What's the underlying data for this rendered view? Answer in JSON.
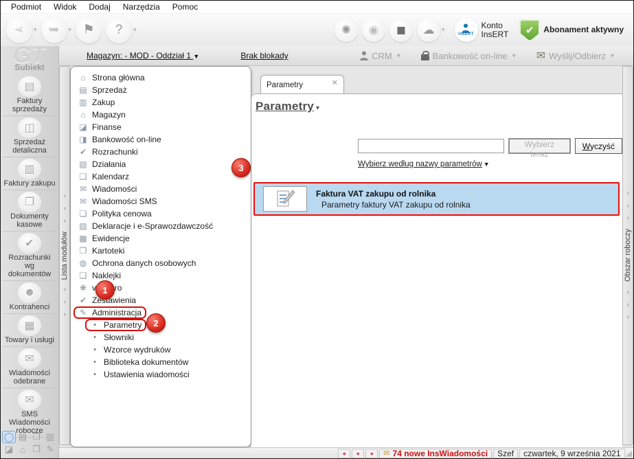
{
  "menu_bar": {
    "items": [
      {
        "label": "Podmiot"
      },
      {
        "label": "Widok"
      },
      {
        "label": "Dodaj"
      },
      {
        "label": "Narzędzia"
      },
      {
        "label": "Pomoc"
      }
    ]
  },
  "toolbar": {
    "left_buttons": [
      {
        "icon_name": "back-arrow-icon",
        "glyph": "➢",
        "dropdown": true,
        "disabled": true,
        "flip": true
      },
      {
        "icon_name": "forward-arrow-icon",
        "glyph": "➥",
        "dropdown": true,
        "disabled": true,
        "flip": false
      },
      {
        "icon_name": "flag-icon",
        "glyph": "⚑",
        "dropdown": false,
        "disabled": false,
        "flip": false
      },
      {
        "icon_name": "help-icon",
        "glyph": "?",
        "dropdown": true,
        "disabled": false,
        "flip": false
      }
    ],
    "refresh_glyph": "✺",
    "globe_glyph": "◉",
    "cube_glyph": "◼",
    "cloud_glyph": "☁",
    "insert_badge": "InsERT",
    "konto_label": "Konto\nInsERT",
    "shield_check": "✔",
    "abonament_label": "Abonament aktywny"
  },
  "context_bar": {
    "magazyn_link": "Magazyn: - MOD - Oddział 1",
    "magazyn_dd": "▼",
    "brak_blokady": "Brak blokady",
    "crm_label": "CRM",
    "bank_label": "Bankowość on-line",
    "send_label": "Wyślij/Odbierz",
    "caret": "▼"
  },
  "sidebar": {
    "logo_gt": "GT",
    "logo_sub": "Subiekt",
    "shortcuts": [
      {
        "glyph": "▤",
        "label": "Faktury sprzedaży"
      },
      {
        "glyph": "◫",
        "label": "Sprzedaż detaliczna"
      },
      {
        "glyph": "▥",
        "label": "Faktury zakupu"
      },
      {
        "glyph": "❐",
        "label": "Dokumenty kasowe"
      },
      {
        "glyph": "✔",
        "label": "Rozrachunki wg dokumentów"
      },
      {
        "glyph": "☻",
        "label": "Kontrahenci"
      },
      {
        "glyph": "▦",
        "label": "Towary i usługi"
      },
      {
        "glyph": "✉",
        "label": "Wiadomości odebrane"
      },
      {
        "glyph": "✉",
        "label": "SMS Wiadomości robocze"
      }
    ],
    "bottom_icons": [
      {
        "glyph": "◯",
        "selected": true
      },
      {
        "glyph": "▤",
        "selected": false
      },
      {
        "glyph": "❒",
        "selected": false
      },
      {
        "glyph": "▥",
        "selected": false
      },
      {
        "glyph": "◪",
        "selected": false
      },
      {
        "glyph": "⌂",
        "selected": false
      },
      {
        "glyph": "❐",
        "selected": false
      },
      {
        "glyph": "✎",
        "selected": false
      }
    ]
  },
  "left_strip": {
    "label": "Lista modułów",
    "chevron": "›"
  },
  "right_strip": {
    "label": "Obszar roboczy",
    "chevron": "›"
  },
  "modules": {
    "items": [
      {
        "icon": "⌂",
        "label": "Strona główna",
        "sub": false,
        "outlined": false
      },
      {
        "icon": "▤",
        "label": "Sprzedaż",
        "sub": false,
        "outlined": false
      },
      {
        "icon": "▥",
        "label": "Zakup",
        "sub": false,
        "outlined": false
      },
      {
        "icon": "⌂",
        "label": "Magazyn",
        "sub": false,
        "outlined": false
      },
      {
        "icon": "◪",
        "label": "Finanse",
        "sub": false,
        "outlined": false
      },
      {
        "icon": "◨",
        "label": "Bankowość on-line",
        "sub": false,
        "outlined": false
      },
      {
        "icon": "✔",
        "label": "Rozrachunki",
        "sub": false,
        "outlined": false
      },
      {
        "icon": "▧",
        "label": "Działania",
        "sub": false,
        "outlined": false
      },
      {
        "icon": "❏",
        "label": "Kalendarz",
        "sub": false,
        "outlined": false
      },
      {
        "icon": "✉",
        "label": "Wiadomości",
        "sub": false,
        "outlined": false
      },
      {
        "icon": "✉",
        "label": "Wiadomości SMS",
        "sub": false,
        "outlined": false
      },
      {
        "icon": "❏",
        "label": "Polityka cenowa",
        "sub": false,
        "outlined": false
      },
      {
        "icon": "▨",
        "label": "Deklaracje i e-Sprawozdawczość",
        "sub": false,
        "outlined": false
      },
      {
        "icon": "▩",
        "label": "Ewidencje",
        "sub": false,
        "outlined": false
      },
      {
        "icon": "❐",
        "label": "Kartoteki",
        "sub": false,
        "outlined": false
      },
      {
        "icon": "◍",
        "label": "Ochrona danych osobowych",
        "sub": false,
        "outlined": false
      },
      {
        "icon": "❑",
        "label": "Naklejki",
        "sub": false,
        "outlined": false
      },
      {
        "icon": "❋",
        "label": "vendero",
        "sub": false,
        "outlined": false
      },
      {
        "icon": "✔",
        "label": "Zestawienia",
        "sub": false,
        "outlined": false
      },
      {
        "icon": "✎",
        "label": "Administracja",
        "sub": false,
        "outlined": true
      },
      {
        "icon": "•",
        "label": "Parametry",
        "sub": true,
        "outlined": true
      },
      {
        "icon": "•",
        "label": "Słowniki",
        "sub": true,
        "outlined": false
      },
      {
        "icon": "•",
        "label": "Wzorce wydruków",
        "sub": true,
        "outlined": false
      },
      {
        "icon": "•",
        "label": "Biblioteka dokumentów",
        "sub": true,
        "outlined": false
      },
      {
        "icon": "•",
        "label": "Ustawienia wiadomości",
        "sub": true,
        "outlined": false
      }
    ]
  },
  "main": {
    "tab_label": "Parametry",
    "tab_close": "✕",
    "page_title": "Parametry",
    "page_title_dd": "▾",
    "search": {
      "value": "",
      "placeholder": ""
    },
    "choose_button": "Wybierz teraz",
    "clear_button_prefix": "W",
    "clear_button_rest": "yczyść",
    "filter_link": "Wybierz według nazwy parametrów",
    "filter_dd": "▼",
    "result": {
      "title": "Faktura VAT zakupu od rolnika",
      "subtitle": "Parametry faktury VAT zakupu od rolnika"
    }
  },
  "callouts": [
    {
      "number": "1"
    },
    {
      "number": "2"
    },
    {
      "number": "3"
    }
  ],
  "statusbar": {
    "dots": [
      {
        "glyph": "●"
      },
      {
        "glyph": "●"
      },
      {
        "glyph": "●"
      }
    ],
    "mail_env": "✉",
    "mail_text": "74 nowe InsWiadomości",
    "user": "Szef",
    "date": "czwartek, 9 września 2021",
    "grip": "◢"
  }
}
